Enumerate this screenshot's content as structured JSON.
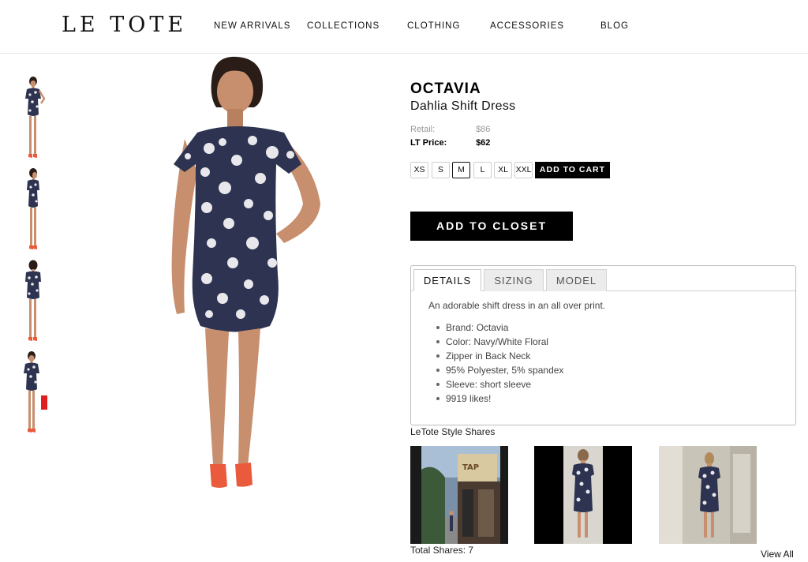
{
  "header": {
    "logo": "LE TOTE",
    "nav": [
      "NEW ARRIVALS",
      "COLLECTIONS",
      "CLOTHING",
      "ACCESSORIES",
      "BLOG"
    ]
  },
  "product": {
    "brand": "OCTAVIA",
    "name": "Dahlia Shift Dress",
    "retail_label": "Retail:",
    "retail_price": "$86",
    "lt_label": "LT Price:",
    "lt_price": "$62",
    "sizes": [
      "XS",
      "S",
      "M",
      "L",
      "XL",
      "XXL"
    ],
    "selected_size": "M",
    "add_to_cart": "ADD TO CART",
    "add_to_closet": "ADD TO CLOSET"
  },
  "tabs": {
    "items": [
      "DETAILS",
      "SIZING",
      "MODEL"
    ],
    "active": "DETAILS"
  },
  "details": {
    "description": "An adorable shift dress in an all over print.",
    "bullets": [
      "Brand: Octavia",
      "Color: Navy/White Floral",
      "Zipper in Back Neck",
      "95% Polyester, 5% spandex",
      "Sleeve: short sleeve",
      "9919 likes!"
    ]
  },
  "shares": {
    "title": "LeTote Style Shares",
    "total": "Total Shares: 7",
    "view_all": "View All"
  },
  "colors": {
    "dress": "#2d3350",
    "print": "#e8e8ec",
    "skin": "#c88f6e",
    "shoes": "#ea5a3c",
    "hair": "#2a1d18",
    "button": "#000000"
  }
}
